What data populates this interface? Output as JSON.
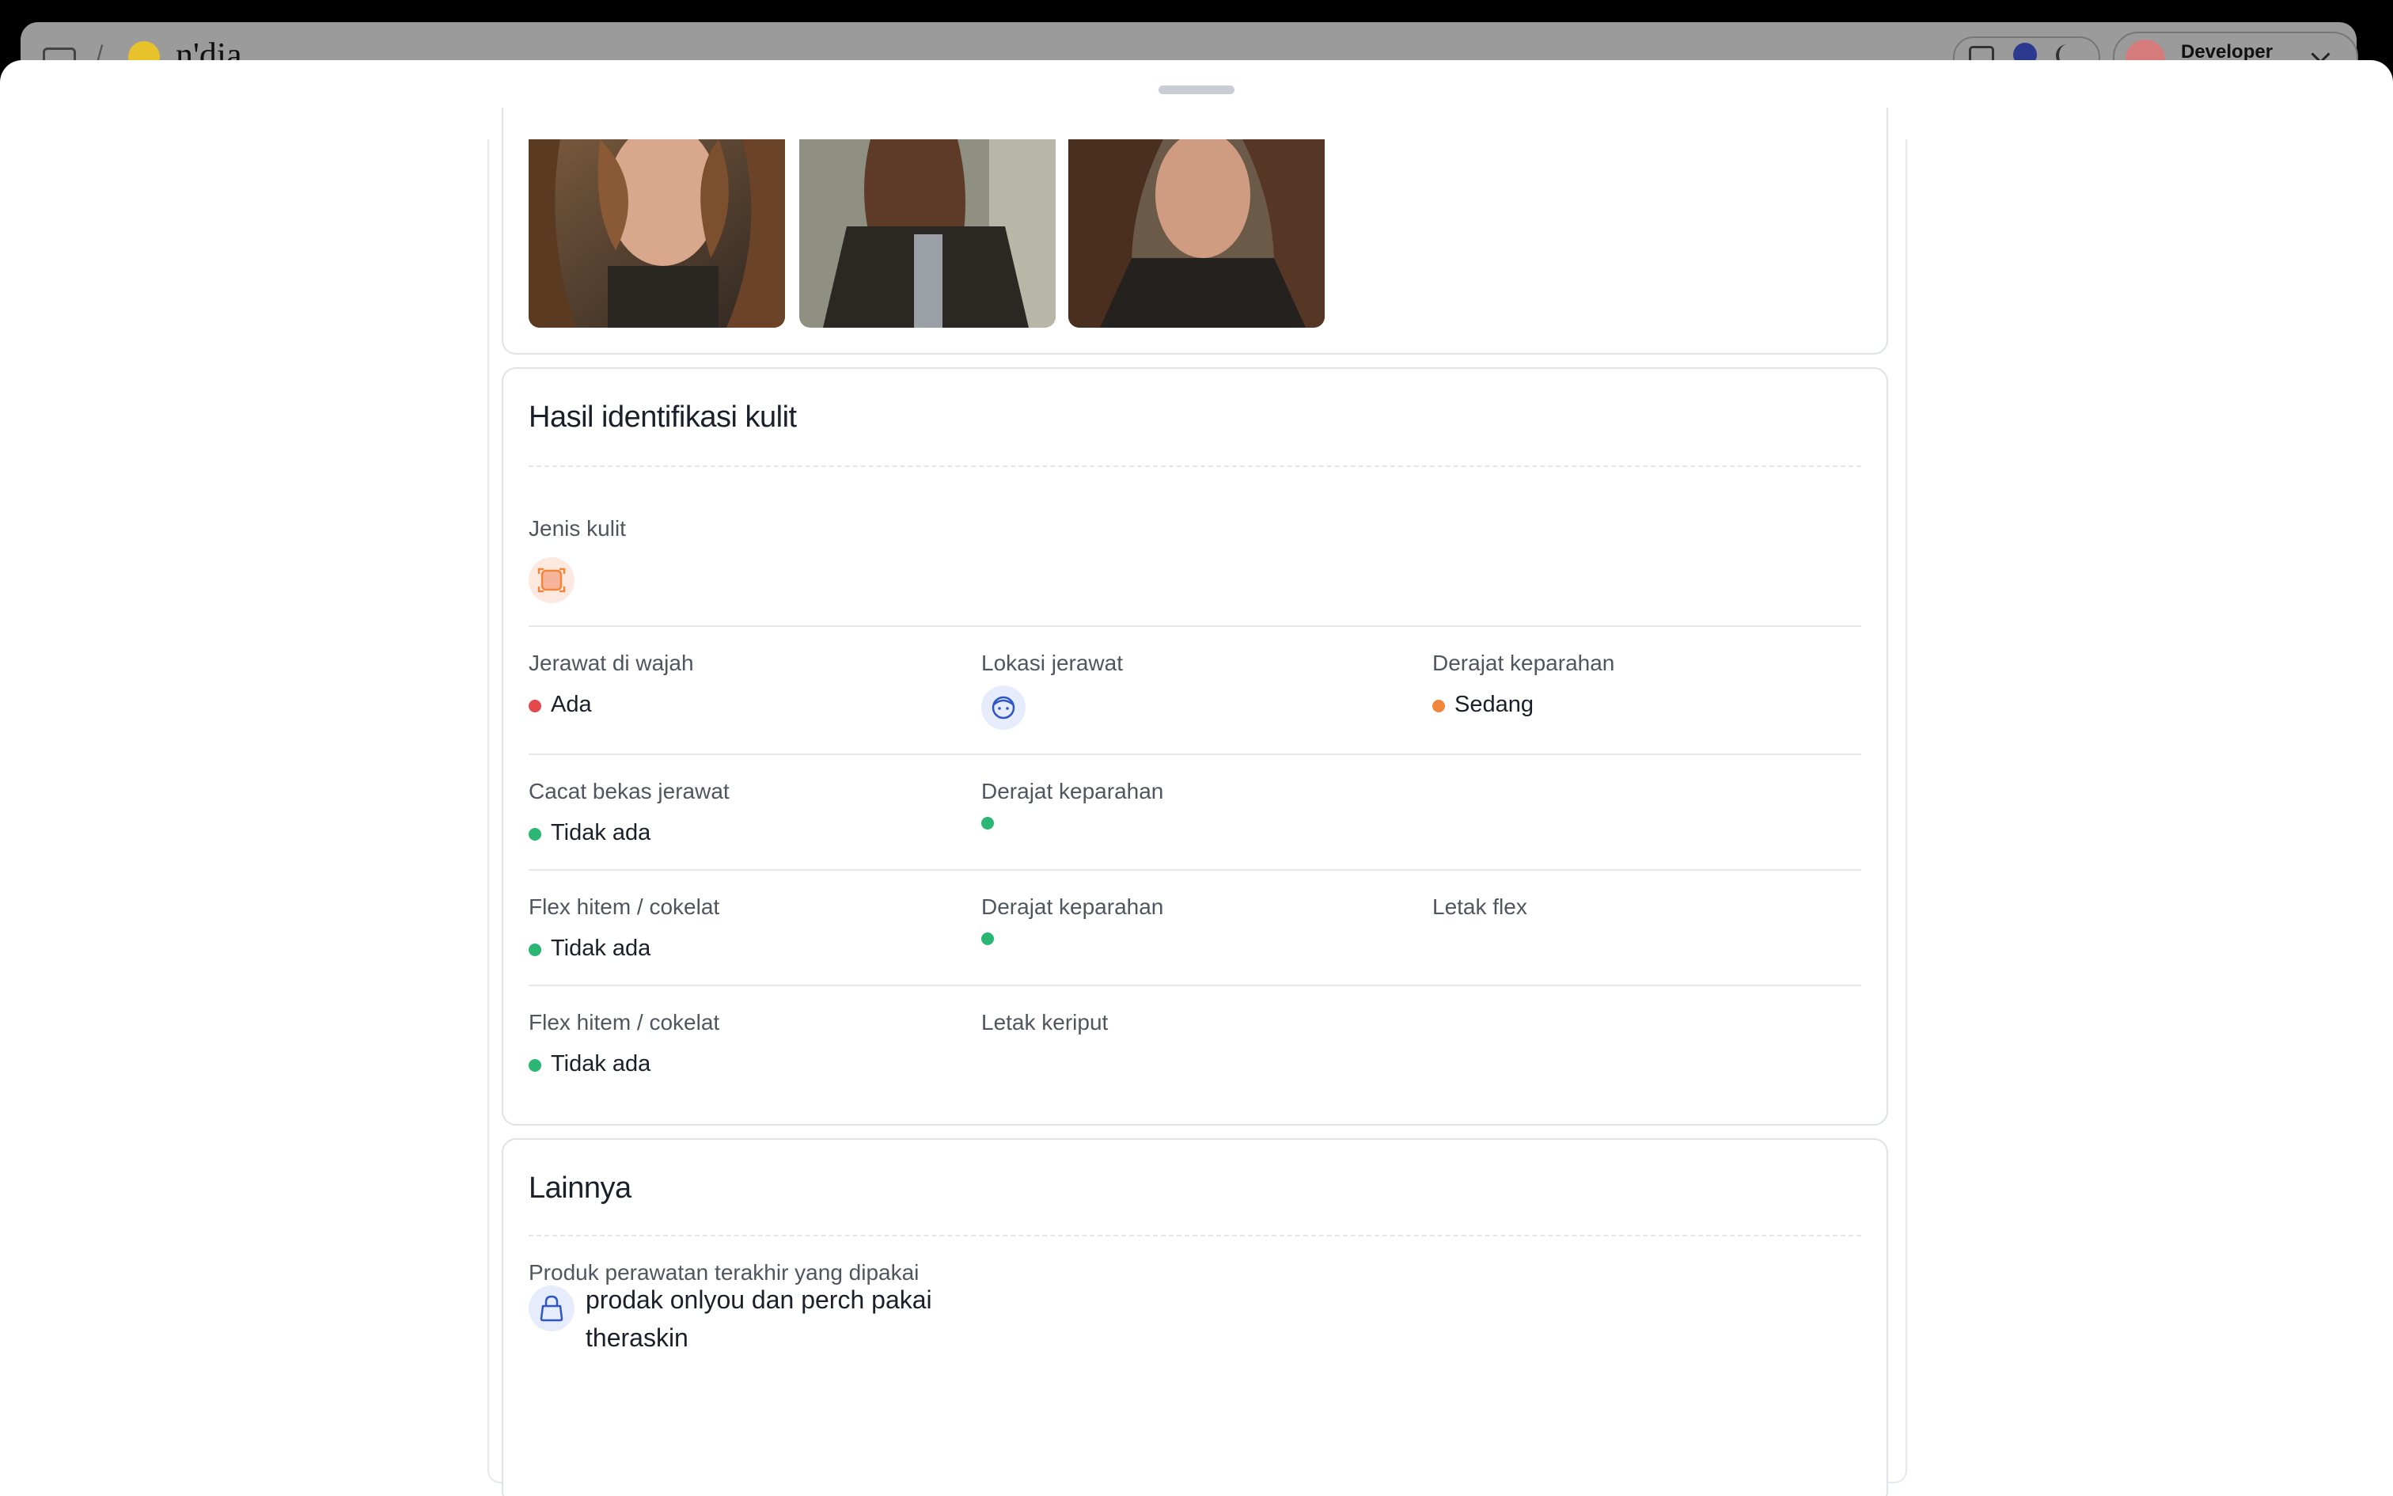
{
  "background_app": {
    "logo_text": "n'dia",
    "user_name": "Developer"
  },
  "skin_section": {
    "title": "Hasil identifikasi kulit",
    "skin_type_label": "Jenis kulit",
    "acne_label": "Jerawat di wajah",
    "acne_value": "Ada",
    "acne_location_label": "Lokasi jerawat",
    "acne_severity_label": "Derajat keparahan",
    "acne_severity_value": "Sedang",
    "scar_label": "Cacat bekas jerawat",
    "scar_value": "Tidak ada",
    "scar_severity_label": "Derajat keparahan",
    "flex_label": "Flex hitem / cokelat",
    "flex_value": "Tidak ada",
    "flex_severity_label": "Derajat keparahan",
    "flex_location_label": "Letak flex",
    "wrinkle_label": "Flex hitem / cokelat",
    "wrinkle_value": "Tidak ada",
    "wrinkle_location_label": "Letak keriput"
  },
  "other_section": {
    "title": "Lainnya",
    "product_label": "Produk perawatan terakhir yang dipakai",
    "product_value": "prodak onlyou dan perch pakai theraskin"
  },
  "colors": {
    "status_yes": "#e5484d",
    "status_no": "#2bb673",
    "severity_medium": "#f0853c",
    "icon_blue": "#2f56c8",
    "icon_orange": "#f0853c"
  }
}
